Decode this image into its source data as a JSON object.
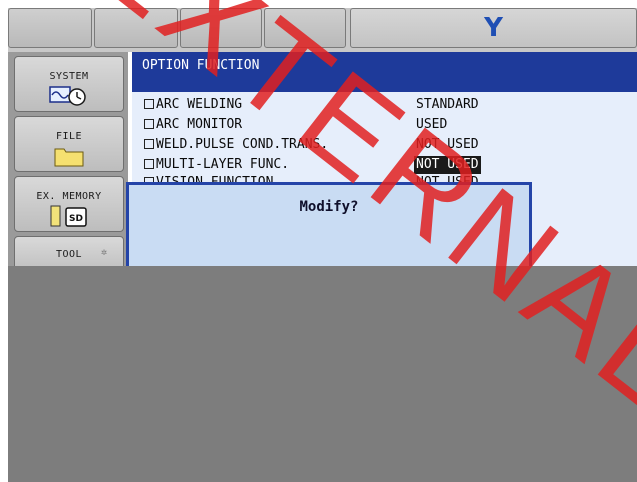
{
  "header": {
    "logo_text": "Y"
  },
  "menu": {
    "items": [
      {
        "label": "SYSTEM",
        "icon": "system-clock-icon"
      },
      {
        "label": "FILE",
        "icon": "folder-icon"
      },
      {
        "label": "EX. MEMORY",
        "icon": "sd-card-icon"
      },
      {
        "label": "TOOL",
        "icon": "tool-icon"
      }
    ]
  },
  "panel": {
    "title": "OPTION FUNCTION",
    "rows": [
      {
        "name": "ARC WELDING",
        "value": "STANDARD",
        "selected": false
      },
      {
        "name": "ARC MONITOR",
        "value": "USED",
        "selected": false
      },
      {
        "name": "WELD.PULSE COND.TRANS.",
        "value": "NOT USED",
        "selected": false
      },
      {
        "name": "MULTI-LAYER FUNC.",
        "value": "NOT USED",
        "selected": true
      },
      {
        "name": "VISION FUNCTION",
        "value": "NOT USED",
        "selected": false
      }
    ]
  },
  "dialog": {
    "text": "Modify?"
  },
  "watermark": {
    "text": "EXTERNAL",
    "color": "#e02020"
  },
  "colors": {
    "title_bar": "#1e3a9a",
    "panel_bg": "#e6eefb",
    "dialog_bg": "#c9dcf3",
    "dialog_border": "#2444a8",
    "logo": "#1f4fb4"
  }
}
